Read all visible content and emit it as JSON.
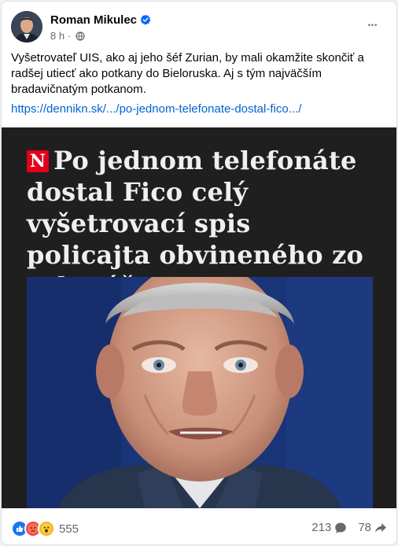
{
  "post": {
    "author": "Roman Mikulec",
    "time": "8 h",
    "separator": "·",
    "text": "Vyšetrovateľ UIS, ako aj jeho šéf Zurian, by mali okamžite skončiť a radšej utiecť ako potkany do Bieloruska. Aj s tým najväčším bradavičnatým potkanom.",
    "link": "https://dennikn.sk/.../po-jednom-telefonate-dostal-fico.../",
    "more_glyph": "•••"
  },
  "article_image": {
    "logo_letter": "N",
    "headline": "Po jednom telefonáte dostal Fico celý vyšetrovací spis policajta obvineného zo sabotáže"
  },
  "footer": {
    "reaction_count": "555",
    "comments": "213",
    "shares": "78"
  },
  "colors": {
    "link": "#0064d1",
    "verified": "#0866ff",
    "like": "#1877f2",
    "angry": "#f33e58",
    "wow": "#f7b125",
    "logo_red": "#e2001a"
  },
  "icons": {
    "verified": "verified-badge-icon",
    "audience": "globe-icon",
    "more": "more-options-icon",
    "like": "like-reaction-icon",
    "angry": "angry-reaction-icon",
    "wow": "wow-reaction-icon",
    "comment": "comment-icon",
    "share": "share-icon"
  }
}
